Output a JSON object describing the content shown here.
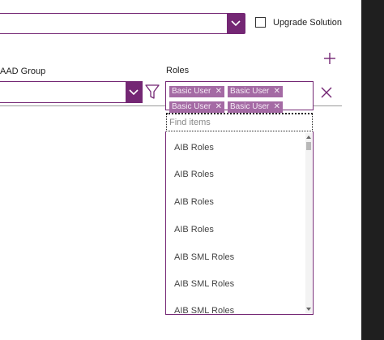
{
  "top": {
    "upgrade_label": "Upgrade Solution"
  },
  "filters": {
    "aad_group_label": "AAD Group",
    "roles_label": "Roles"
  },
  "selected_roles": [
    {
      "label": "Basic User"
    },
    {
      "label": "Basic User"
    },
    {
      "label": "Basic User"
    },
    {
      "label": "Basic User"
    }
  ],
  "search": {
    "placeholder": "Find items"
  },
  "items": [
    {
      "label": "AIB Roles"
    },
    {
      "label": "AIB Roles"
    },
    {
      "label": "AIB Roles"
    },
    {
      "label": "AIB Roles"
    },
    {
      "label": "AIB SML Roles"
    },
    {
      "label": "AIB SML Roles"
    },
    {
      "label": "AIB SML Roles"
    }
  ],
  "colors": {
    "accent": "#742774",
    "tag": "#a46aa4",
    "side_panel": "#1f1f1f"
  },
  "icons": {
    "chevron": "chevron-down-icon",
    "filter": "filter-icon",
    "add": "plus-icon",
    "clear": "close-icon",
    "tag_remove": "close-icon"
  }
}
